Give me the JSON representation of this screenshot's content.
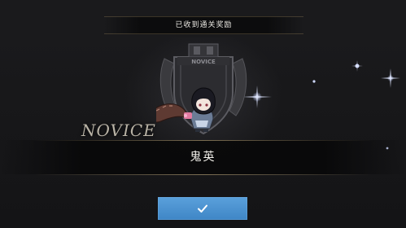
{
  "header": {
    "title": "已收到通关奖励"
  },
  "reward": {
    "rank_script": "NOVICE",
    "rank_emblem_text": "NOVICE",
    "character_name": "鬼英"
  },
  "actions": {
    "confirm_icon": "check-icon"
  },
  "colors": {
    "accent_blue": "#4a92d2",
    "gold_line": "#a8966e",
    "background": "#141416"
  }
}
